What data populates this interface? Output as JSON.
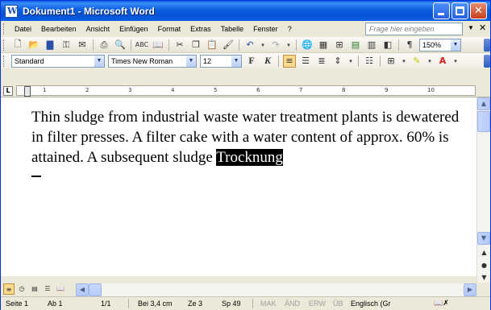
{
  "window": {
    "title": "Dokument1 - Microsoft Word"
  },
  "menu": {
    "items": [
      "Datei",
      "Bearbeiten",
      "Ansicht",
      "Einfügen",
      "Format",
      "Extras",
      "Tabelle",
      "Fenster",
      "?"
    ],
    "help_placeholder": "Frage hier eingeben"
  },
  "toolbar": {
    "zoom": "150%",
    "style": "Standard",
    "font": "Times New Roman",
    "size": "12",
    "bold_label": "F",
    "italic_label": "K"
  },
  "ruler": {
    "numbers": [
      "1",
      "2",
      "3",
      "4",
      "5",
      "6",
      "7",
      "8",
      "9",
      "10"
    ],
    "corner": "L"
  },
  "document": {
    "text_before": "Thin sludge from industrial waste water treatment plants is dewatered in filter presses. A filter cake with a water content of approx. 60% is attained. A subsequent sludge ",
    "selected_word": "Trocknung"
  },
  "statusbar": {
    "page": "Seite 1",
    "section": "Ab 1",
    "pages": "1/1",
    "position": "Bei 3,4 cm",
    "line": "Ze 3",
    "column": "Sp 49",
    "mak": "MAK",
    "and": "ÄND",
    "erw": "ERW",
    "ub": "ÜB",
    "language": "Englisch (Gr"
  },
  "colors": {
    "titlebar": "#0a5fe4",
    "highlight": "#000000"
  }
}
